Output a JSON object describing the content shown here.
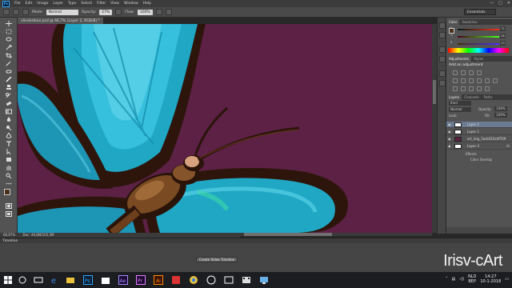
{
  "app": {
    "logo_text": "Ps",
    "menu": [
      "File",
      "Edit",
      "Image",
      "Layer",
      "Type",
      "Select",
      "Filter",
      "View",
      "Window",
      "Help"
    ],
    "window_controls": [
      "—",
      "□",
      "✕"
    ]
  },
  "options_bar": {
    "mode_label": "Mode:",
    "mode_value": "Normal",
    "opacity_label": "Opacity:",
    "opacity_value": "27%",
    "flow_label": "Flow:",
    "flow_value": "100%",
    "workspace": "Essentials"
  },
  "document": {
    "tab_title": "vlinderblue.psd @ 66,7% (Layer 2, RGB/8) *",
    "zoom": "66,67%",
    "doc_size": "Doc: 49,8M/105,5M",
    "canvas_color": "#5c2145"
  },
  "color_panel": {
    "tabs": [
      "Color",
      "Swatches"
    ],
    "sliders": [
      {
        "label": "R",
        "value": "72"
      },
      {
        "label": "G",
        "value": "46"
      },
      {
        "label": "B",
        "value": "23"
      }
    ]
  },
  "adjustments_panel": {
    "tabs": [
      "Adjustments",
      "Styles"
    ],
    "title": "Add an adjustment"
  },
  "layers_panel": {
    "tabs": [
      "Layers",
      "Channels",
      "Paths"
    ],
    "kind_filter": "Kind",
    "blend_mode": "Normal",
    "opacity_label": "Opacity:",
    "opacity_value": "100%",
    "lock_label": "Lock:",
    "fill_label": "Fill:",
    "fill_value": "100%",
    "layers": [
      {
        "name": "Layer 2",
        "selected": true
      },
      {
        "name": "Layer 1",
        "selected": false
      },
      {
        "name": "art_img_5adc610c4f709",
        "selected": false
      },
      {
        "name": "Layer 3",
        "selected": false,
        "fx": "fx"
      }
    ],
    "effects_label": "Effects",
    "effect_item": "Color Overlay"
  },
  "timeline": {
    "tab_label": "Timeline",
    "create_button": "Create Video Timeline"
  },
  "watermark": "Irisv-cArt",
  "taskbar": {
    "language": "NLD",
    "language_sub": "BEP",
    "time": "14:27",
    "date": "10-1-2018"
  }
}
